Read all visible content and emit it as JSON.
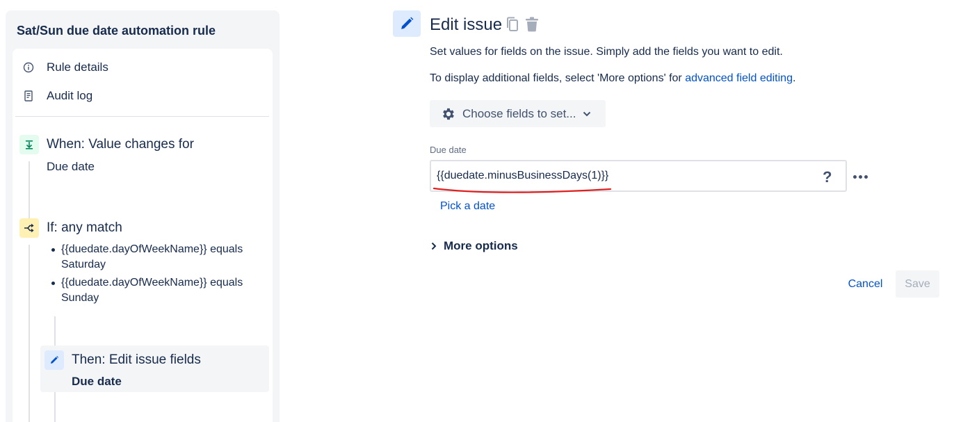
{
  "rule": {
    "title": "Sat/Sun due date automation rule",
    "nav": [
      {
        "label": "Rule details",
        "icon": "info-icon"
      },
      {
        "label": "Audit log",
        "icon": "document-icon"
      }
    ],
    "trigger": {
      "title": "When: Value changes for",
      "subtitle": "Due date",
      "icon": "trigger-icon"
    },
    "condition": {
      "title": "If: any match",
      "icon": "branch-icon",
      "items": [
        "{{duedate.dayOfWeekName}} equals Saturday",
        "{{duedate.dayOfWeekName}} equals Sunday"
      ]
    },
    "action": {
      "title": "Then: Edit issue fields",
      "subtitle": "Due date",
      "icon": "pencil-icon"
    }
  },
  "editor": {
    "title": "Edit issue",
    "description": "Set values for fields on the issue. Simply add the fields you want to edit.",
    "additional_prefix": "To display additional fields, select 'More options' for ",
    "additional_link": "advanced field editing",
    "additional_suffix": ".",
    "choose_fields_label": "Choose fields to set...",
    "field": {
      "label": "Due date",
      "value": "{{duedate.minusBusinessDays(1)}}",
      "help": "?"
    },
    "pick_date_label": "Pick a date",
    "more_options_label": "More options",
    "cancel_label": "Cancel",
    "save_label": "Save"
  },
  "colors": {
    "link": "#0052cc",
    "text": "#172b4d",
    "trigger_bg": "#e3fcef",
    "trigger_fg": "#00875a",
    "condition_bg": "#fff0b3",
    "condition_fg": "#172b4d",
    "action_bg": "#deebff",
    "action_fg": "#0052cc",
    "annotation_underline": "#e0201e"
  }
}
